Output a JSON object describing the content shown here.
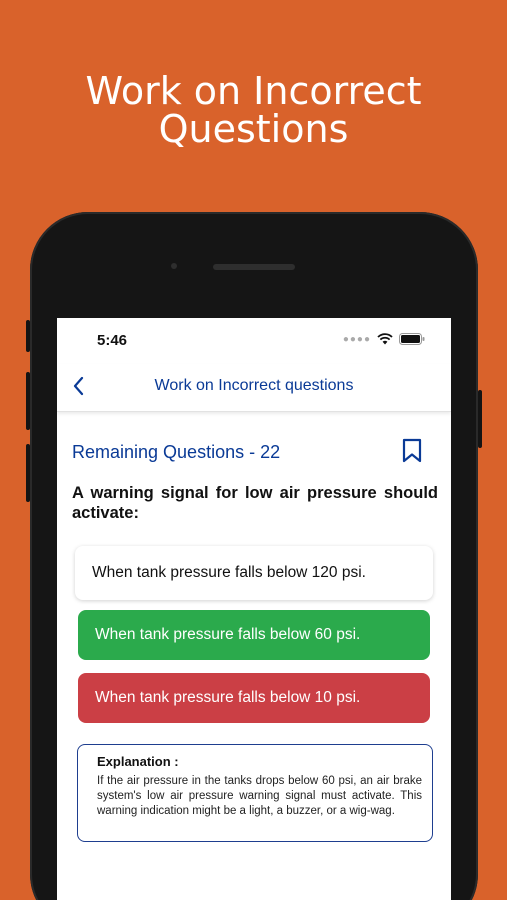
{
  "headline": {
    "line1": "Work on Incorrect",
    "line2": "Questions"
  },
  "colors": {
    "background": "#D9622B",
    "accent": "#0A3A96",
    "correct": "#2BAA4C",
    "wrong": "#CB3F45"
  },
  "status_bar": {
    "time": "5:46",
    "icons": [
      "signal-dots-icon",
      "wifi-icon",
      "battery-icon"
    ]
  },
  "nav": {
    "back_icon": "chevron-left-icon",
    "title": "Work on Incorrect questions"
  },
  "quiz": {
    "remaining_label": "Remaining Questions - 22",
    "bookmark_icon": "bookmark-icon",
    "question": "A warning signal for low air pressure should activate:",
    "options": [
      {
        "text": "When tank pressure falls below 120 psi.",
        "state": "neutral"
      },
      {
        "text": "When tank pressure falls below 60 psi.",
        "state": "correct"
      },
      {
        "text": "When tank pressure falls below 10 psi.",
        "state": "wrong"
      }
    ],
    "explanation": {
      "title": "Explanation :",
      "body": "If the air pressure in the tanks drops below 60 psi, an air brake system's low air pressure warning signal must activate. This warning indication might be a light, a buzzer, or a wig-wag."
    }
  }
}
